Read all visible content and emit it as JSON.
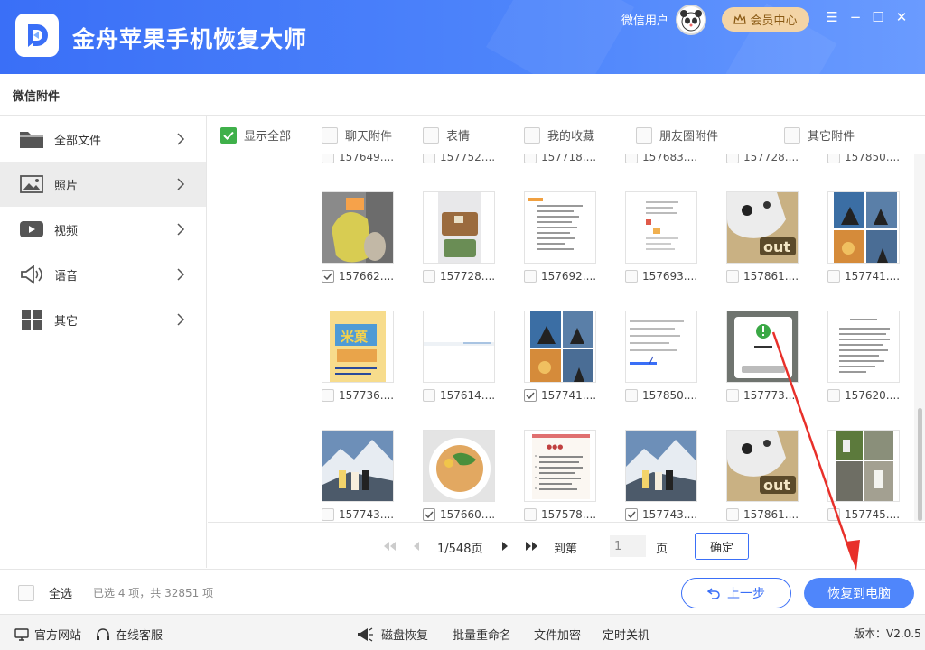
{
  "header": {
    "app_title": "金舟苹果手机恢复大师",
    "user_name": "微信用户",
    "vip_label": "会员中心",
    "accent": "#3a6ff7"
  },
  "subheader": {
    "title": "微信附件"
  },
  "sidebar": {
    "items": [
      {
        "label": "全部文件",
        "icon": "folder-icon"
      },
      {
        "label": "照片",
        "icon": "image-icon"
      },
      {
        "label": "视频",
        "icon": "video-play-icon"
      },
      {
        "label": "语音",
        "icon": "speaker-icon"
      },
      {
        "label": "其它",
        "icon": "grid-icon"
      }
    ]
  },
  "filters": [
    {
      "label": "显示全部",
      "checked": true
    },
    {
      "label": "聊天附件",
      "checked": false
    },
    {
      "label": "表情",
      "checked": false
    },
    {
      "label": "我的收藏",
      "checked": false
    },
    {
      "label": "朋友圈附件",
      "checked": false
    },
    {
      "label": "其它附件",
      "checked": false
    }
  ],
  "partial_row": [
    "157649....",
    "157752....",
    "157718....",
    "157683....",
    "157728....",
    "157850...."
  ],
  "grid": [
    {
      "name": "157662....",
      "checked": true,
      "thumb": "food-bag-photo"
    },
    {
      "name": "157728....",
      "checked": false,
      "thumb": "lunchbox-photo"
    },
    {
      "name": "157692....",
      "checked": false,
      "thumb": "chat-screenshot"
    },
    {
      "name": "157693....",
      "checked": false,
      "thumb": "app-screenshot"
    },
    {
      "name": "157861....",
      "checked": false,
      "thumb": "cat-out-photo"
    },
    {
      "name": "157741....",
      "checked": false,
      "thumb": "collage-photo"
    },
    {
      "name": "157736....",
      "checked": false,
      "thumb": "product-poster"
    },
    {
      "name": "157614....",
      "checked": false,
      "thumb": "blank-screenshot"
    },
    {
      "name": "157741....",
      "checked": true,
      "thumb": "collage-photo"
    },
    {
      "name": "157850....",
      "checked": false,
      "thumb": "code-screenshot"
    },
    {
      "name": "157773....",
      "checked": false,
      "thumb": "dialog-screenshot"
    },
    {
      "name": "157620....",
      "checked": false,
      "thumb": "document-page"
    },
    {
      "name": "157743....",
      "checked": false,
      "thumb": "mountain-photo"
    },
    {
      "name": "157660....",
      "checked": true,
      "thumb": "noodle-bowl-photo"
    },
    {
      "name": "157578....",
      "checked": false,
      "thumb": "notebook-page"
    },
    {
      "name": "157743....",
      "checked": true,
      "thumb": "mountain-photo"
    },
    {
      "name": "157861....",
      "checked": false,
      "thumb": "cat-out-photo"
    },
    {
      "name": "157745....",
      "checked": false,
      "thumb": "outdoor-collage"
    }
  ],
  "pager": {
    "page_text": "1/548页",
    "goto_label": "到第",
    "page_input": "1",
    "page_unit": "页",
    "confirm_label": "确定"
  },
  "actions": {
    "select_all": "全选",
    "selection_info": "已选 4 项，共 32851 项",
    "prev_label": "上一步",
    "restore_label": "恢复到电脑"
  },
  "footer": {
    "website": "官方网站",
    "support": "在线客服",
    "disk_recovery": "磁盘恢复",
    "batch_rename": "批量重命名",
    "file_encrypt": "文件加密",
    "timed_shutdown": "定时关机",
    "version": "版本：V2.0.5"
  }
}
